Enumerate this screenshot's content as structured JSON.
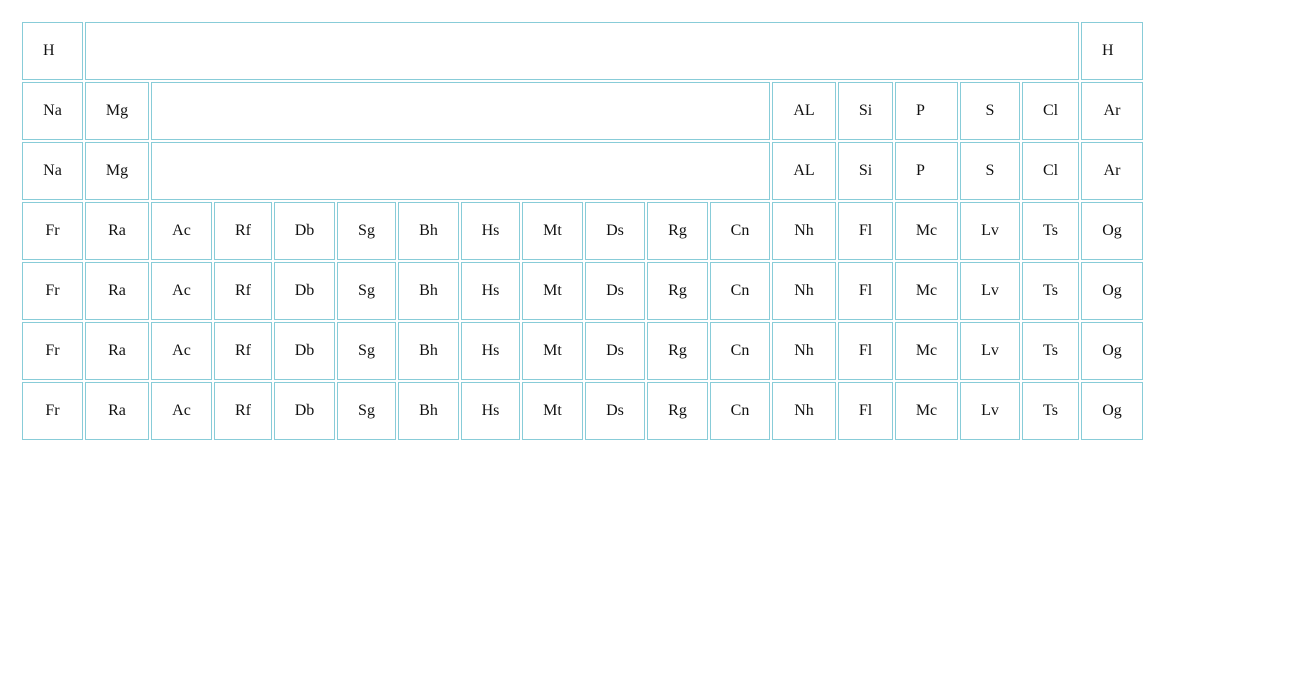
{
  "rows": [
    [
      "H",
      "H"
    ],
    [
      "Na",
      "Mg",
      "AL",
      "Si",
      "P",
      "S",
      "Cl",
      "Ar"
    ],
    [
      "Na",
      "Mg",
      "AL",
      "Si",
      "P",
      "S",
      "Cl",
      "Ar"
    ],
    [
      "Fr",
      "Ra",
      "Ac",
      "Rf",
      "Db",
      "Sg",
      "Bh",
      "Hs",
      "Mt",
      "Ds",
      "Rg",
      "Cn",
      "Nh",
      "Fl",
      "Mc",
      "Lv",
      "Ts",
      "Og"
    ],
    [
      "Fr",
      "Ra",
      "Ac",
      "Rf",
      "Db",
      "Sg",
      "Bh",
      "Hs",
      "Mt",
      "Ds",
      "Rg",
      "Cn",
      "Nh",
      "Fl",
      "Mc",
      "Lv",
      "Ts",
      "Og"
    ],
    [
      "Fr",
      "Ra",
      "Ac",
      "Rf",
      "Db",
      "Sg",
      "Bh",
      "Hs",
      "Mt",
      "Ds",
      "Rg",
      "Cn",
      "Nh",
      "Fl",
      "Mc",
      "Lv",
      "Ts",
      "Og"
    ],
    [
      "Fr",
      "Ra",
      "Ac",
      "Rf",
      "Db",
      "Sg",
      "Bh",
      "Hs",
      "Mt",
      "Ds",
      "Rg",
      "Cn",
      "Nh",
      "Fl",
      "Mc",
      "Lv",
      "Ts",
      "Og"
    ]
  ],
  "colors": {
    "cell_border": "#88ccd8",
    "text": "#111111",
    "background": "#ffffff"
  }
}
